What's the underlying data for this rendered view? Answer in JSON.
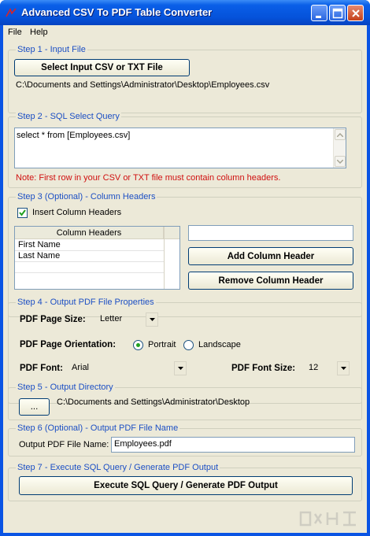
{
  "window": {
    "title": "Advanced CSV To PDF Table Converter"
  },
  "menu": {
    "items": [
      "File",
      "Help"
    ]
  },
  "step1": {
    "title": "Step 1 - Input File",
    "button_label": "Select Input CSV or TXT File",
    "file_path": "C:\\Documents and Settings\\Administrator\\Desktop\\Employees.csv"
  },
  "step2": {
    "title": "Step 2 - SQL Select Query",
    "query": "select * from [Employees.csv]",
    "note": "Note: First row in your CSV or TXT file must contain column headers."
  },
  "step3": {
    "title": "Step 3 (Optional) - Column Headers",
    "checkbox_label": "Insert Column Headers",
    "checkbox_checked": true,
    "grid_header": "Column Headers",
    "rows": [
      "First Name",
      "Last Name"
    ],
    "header_input_value": "",
    "add_button": "Add Column Header",
    "remove_button": "Remove Column Header"
  },
  "step4": {
    "title": "Step 4 - Output PDF File Properties",
    "page_size_label": "PDF Page Size:",
    "page_size_value": "Letter",
    "orientation_label": "PDF Page Orientation:",
    "portrait_label": "Portrait",
    "landscape_label": "Landscape",
    "orientation_selected": "Portrait",
    "font_label": "PDF Font:",
    "font_value": "Arial",
    "font_size_label": "PDF Font Size:",
    "font_size_value": "12"
  },
  "step5": {
    "title": "Step 5 - Output Directory",
    "browse_label": "...",
    "directory": "C:\\Documents and Settings\\Administrator\\Desktop"
  },
  "step6": {
    "title": "Step 6 (Optional) - Output PDF File Name",
    "label": "Output PDF File Name:",
    "value": "Employees.pdf"
  },
  "step7": {
    "title": "Step 7 - Execute SQL Query / Generate PDF Output",
    "button_label": "Execute SQL Query / Generate PDF Output"
  },
  "colors": {
    "titlebar": "#0552da",
    "client_bg": "#ece9d8",
    "group_title": "#1c4fc4",
    "note": "#d01010"
  }
}
